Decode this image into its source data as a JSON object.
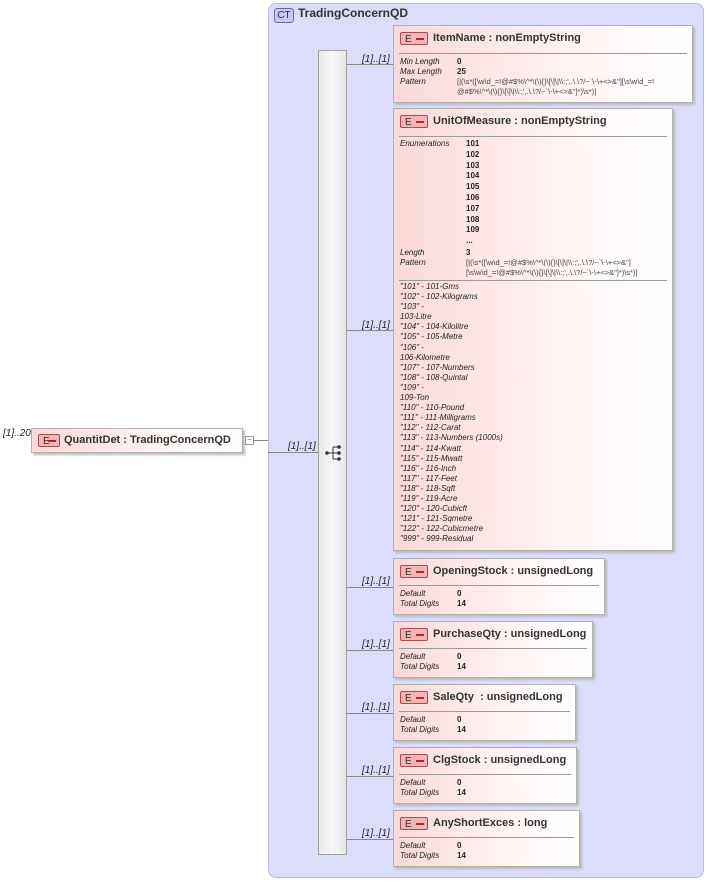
{
  "root": {
    "multiplicity": "[1]..20",
    "badge": "E",
    "label": "QuantitDet : TradingConcernQD"
  },
  "complex_type": {
    "badge": "CT",
    "title": "TradingConcernQD"
  },
  "sequence_multiplicity": "[1]..[1]",
  "children": [
    {
      "multiplicity": "[1]..[1]",
      "badge": "E",
      "label": "ItemName : nonEmptyString",
      "props": [
        {
          "k": "Min Length",
          "v": "0"
        },
        {
          "k": "Max Length",
          "v": "25"
        },
        {
          "k": "Pattern",
          "v": "[|(\\s*([\\w\\d_=!@#$%\\^*\\(\\){}\\[\\]\\|\\\\:;',.\\.\\?/~`\\-\\+<>&\"][\\s\\w\\d_=!",
          "v2": "@#$%\\^*\\(\\){}\\[\\]\\|\\\\:;',.\\.\\?/~`\\-\\+<>&\"]*)\\s*)]"
        }
      ]
    },
    {
      "multiplicity": "[1]..[1]",
      "badge": "E",
      "label": "UnitOfMeasure : nonEmptyString",
      "enum_label": "Enumerations",
      "enumerations": [
        "101",
        "102",
        "103",
        "104",
        "105",
        "106",
        "107",
        "108",
        "109",
        "..."
      ],
      "length_label": "Length",
      "length": "3",
      "pattern_label": "Pattern",
      "pattern1": "[|(\\s*([\\w\\d_=!@#$%\\^*\\(\\){}\\[\\]\\|\\\\:;',.\\.\\?/~`\\-\\+<>&\"]",
      "pattern2": "[\\s\\w\\d_=!@#$%\\^*\\(\\){}\\[\\]\\|\\\\:;',.\\.\\?/~`\\-\\+<>&\"]*)\\s*)]",
      "docs": [
        "\"101\" - 101-Gms",
        "\"102\" - 102-Kilograms",
        "\"103\" -",
        "103-Litre",
        "\"104\" - 104-Kilolitre",
        "\"105\" - 105-Metre",
        "\"106\" -",
        "106-Kilometre",
        "\"107\" - 107-Numbers",
        "\"108\" - 108-Quintal",
        "\"109\" -",
        "109-Ton",
        "\"110\" - 110-Pound",
        "\"111\" - 111-Milligrams",
        "\"112\" - 112-Carat",
        "\"113\" - 113-Numbers (1000s)",
        "\"114\" - 114-Kwatt",
        "\"115\" - 115-Mwatt",
        "\"116\" - 116-Inch",
        "\"117\" - 117-Feet",
        "\"118\" - 118-Sqft",
        "\"119\" - 119-Acre",
        "\"120\" - 120-Cubicft",
        "\"121\" - 121-Sqmetre",
        "\"122\" - 122-Cubicmetre",
        "\"999\" - 999-Residual"
      ]
    },
    {
      "multiplicity": "[1]..[1]",
      "badge": "E",
      "label": "OpeningStock : unsignedLong",
      "props": [
        {
          "k": "Default",
          "v": "0"
        },
        {
          "k": "Total Digits",
          "v": "14"
        }
      ]
    },
    {
      "multiplicity": "[1]..[1]",
      "badge": "E",
      "label": "PurchaseQty : unsignedLong",
      "props": [
        {
          "k": "Default",
          "v": "0"
        },
        {
          "k": "Total Digits",
          "v": "14"
        }
      ]
    },
    {
      "multiplicity": "[1]..[1]",
      "badge": "E",
      "label": "SaleQty  : unsignedLong",
      "props": [
        {
          "k": "Default",
          "v": "0"
        },
        {
          "k": "Total Digits",
          "v": "14"
        }
      ]
    },
    {
      "multiplicity": "[1]..[1]",
      "badge": "E",
      "label": "ClgStock : unsignedLong",
      "props": [
        {
          "k": "Default",
          "v": "0"
        },
        {
          "k": "Total Digits",
          "v": "14"
        }
      ]
    },
    {
      "multiplicity": "[1]..[1]",
      "badge": "E",
      "label": "AnyShortExces : long",
      "props": [
        {
          "k": "Default",
          "v": "0"
        },
        {
          "k": "Total Digits",
          "v": "14"
        }
      ]
    }
  ]
}
